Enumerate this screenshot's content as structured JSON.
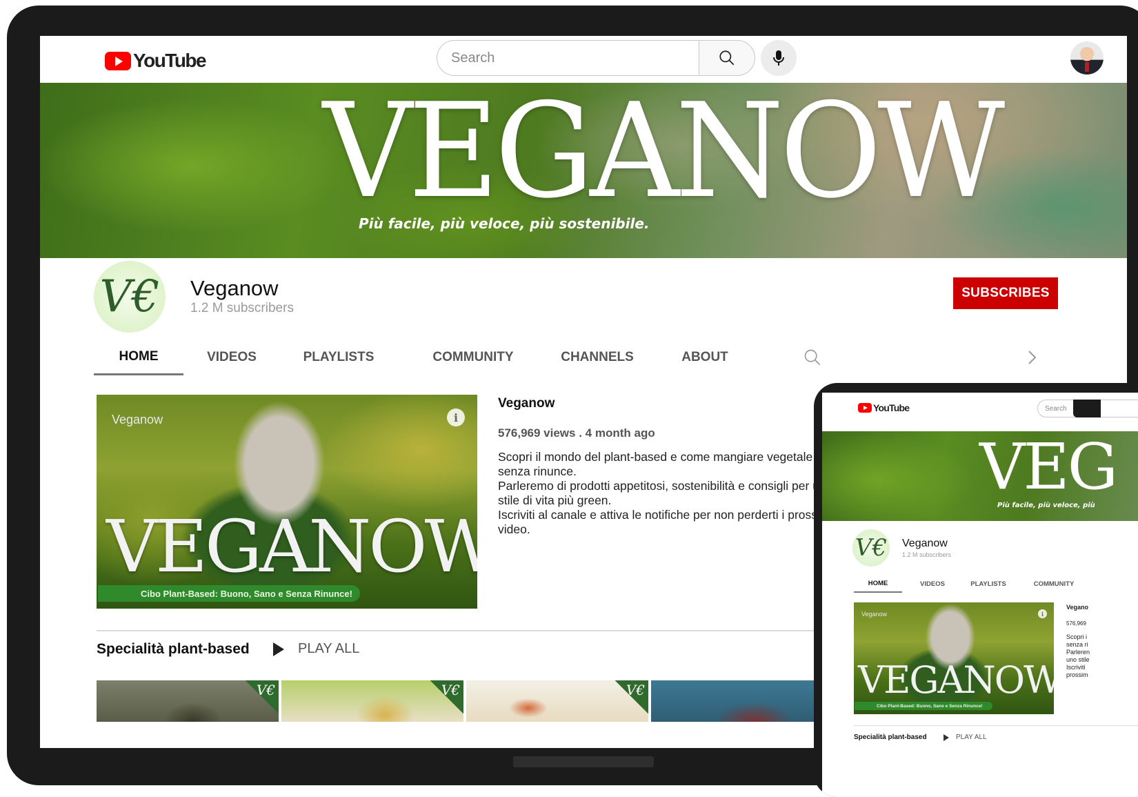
{
  "app": {
    "logo_text": "YouTube"
  },
  "search": {
    "placeholder": "Search"
  },
  "banner": {
    "title": "VEGANOW",
    "tagline": "Più facile, più veloce, più sostenibile."
  },
  "channel": {
    "avatar_glyph": "V€",
    "name": "Veganow",
    "subscribers": "1.2 M subscribers",
    "subscribe_label": "SUBSCRIBES"
  },
  "tabs": [
    {
      "label": "HOME",
      "active": true
    },
    {
      "label": "VIDEOS"
    },
    {
      "label": "PLAYLISTS"
    },
    {
      "label": "COMMUNITY"
    },
    {
      "label": "CHANNELS"
    },
    {
      "label": "ABOUT"
    }
  ],
  "featured": {
    "thumb_channel": "Veganow",
    "thumb_title": "VEGANOW",
    "thumb_caption": "Cibo Plant-Based: Buono, Sano e Senza Rinunce!",
    "title": "Veganow",
    "meta": "576,969 views . 4 month ago",
    "description": [
      "Scopri il mondo del plant-based e come mangiare vegetale senza rinunce.",
      "Parleremo di prodotti appetitosi, sostenibilità e consigli per uno stile di vita più green.",
      "Iscriviti al canale e attiva le notifiche per non perderti i prossimi video."
    ]
  },
  "shelf": {
    "title": "Specialità plant-based",
    "play_all": "PLAY ALL"
  },
  "thumbnails": [
    {
      "badge": "V€",
      "colors": [
        "#6c6f58",
        "#3a3a2a"
      ]
    },
    {
      "badge": "V€",
      "colors": [
        "#b6cf6a",
        "#e7dfc4"
      ]
    },
    {
      "badge": "V€",
      "colors": [
        "#f0ece2",
        "#d9c8a0"
      ]
    },
    {
      "badge": "V€",
      "colors": [
        "#3e6f8a",
        "#6c3a3a"
      ]
    }
  ],
  "tablet": {
    "logo_text": "YouTube",
    "search_placeholder": "Search",
    "banner_title": "VEG",
    "banner_tagline": "Più facile, più veloce, più",
    "channel_name": "Veganow",
    "channel_subscribers": "1.2 M subscribers",
    "tabs": [
      "HOME",
      "VIDEOS",
      "PLAYLISTS",
      "COMMUNITY"
    ],
    "thumb_channel": "Veganow",
    "thumb_title": "VEGANOW",
    "thumb_caption": "Cibo Plant-Based: Buono, Sano e Senza Rinunce!",
    "desc_lines": [
      "Vegano",
      "576,969",
      "Scopri i",
      "senza ri",
      "Parleren",
      "uno stile",
      "Iscriviti",
      "prossim"
    ],
    "shelf_title": "Specialità plant-based",
    "play_all": "PLAY ALL"
  },
  "colors": {
    "accent": "#cc0000",
    "brand_red": "#ff0000",
    "brand_green": "#2f8a2c"
  }
}
